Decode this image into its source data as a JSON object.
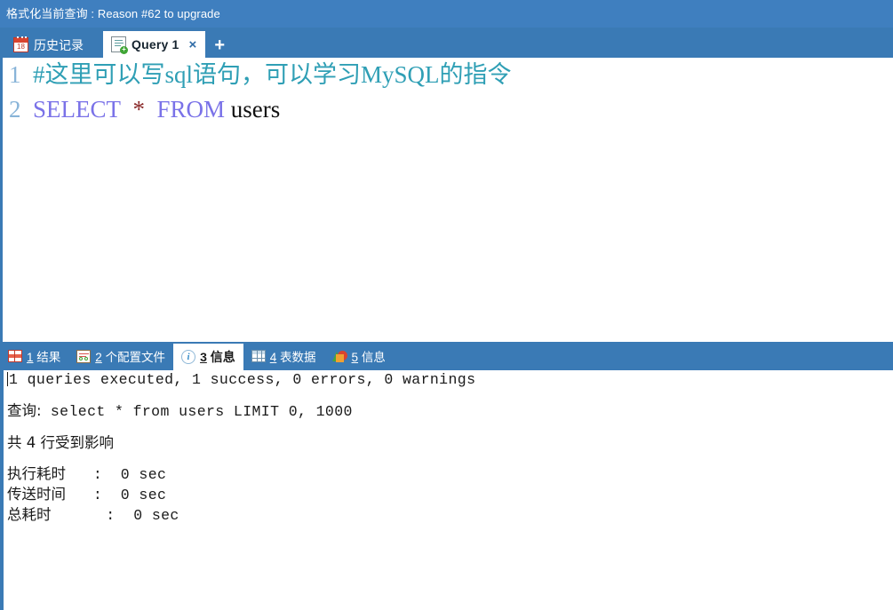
{
  "titlebar": {
    "text": "格式化当前查询 : Reason #62 to upgrade"
  },
  "editor_tabs": {
    "history": {
      "label": "历史记录",
      "icon": "calendar-icon",
      "icon_number": "18"
    },
    "query": {
      "label": "Query 1",
      "icon": "query-document-icon",
      "close": "×"
    },
    "new_tab": "+"
  },
  "code": {
    "lines": [
      {
        "number": "1",
        "tokens": [
          {
            "type": "comment",
            "text": "#这里可以写sql语句，可以学习MySQL的指令"
          }
        ]
      },
      {
        "number": "2",
        "tokens": [
          {
            "type": "keyword",
            "text": "SELECT"
          },
          {
            "type": "plain",
            "text": "  "
          },
          {
            "type": "star",
            "text": "*"
          },
          {
            "type": "plain",
            "text": "  "
          },
          {
            "type": "keyword",
            "text": "FROM"
          },
          {
            "type": "plain",
            "text": " users"
          }
        ]
      }
    ],
    "line1_comment": "#这里可以写sql语句，可以学习MySQL的指令",
    "line2_select": "SELECT",
    "line2_star": "*",
    "line2_from": "FROM",
    "line2_table": "users",
    "line1_number": "1",
    "line2_number": "2"
  },
  "result_tabs": [
    {
      "num": "1",
      "label": "结果",
      "icon": "grid-result-icon",
      "active": false
    },
    {
      "num": "2",
      "label": "个配置文件",
      "icon": "profile-icon",
      "active": false
    },
    {
      "num": "3",
      "label": "信息",
      "icon": "info-circle-icon",
      "active": true
    },
    {
      "num": "4",
      "label": "表数据",
      "icon": "table-grid-icon",
      "active": false
    },
    {
      "num": "5",
      "label": "信息",
      "icon": "pie-chart-icon",
      "active": false
    }
  ],
  "output": {
    "line_executed": "1 queries executed, 1 success, 0 errors, 0 warnings",
    "line_query_label": "查询:",
    "line_query_sql": " select * from users LIMIT 0, 1000",
    "line_rows": "共 4 行受到影响",
    "line_exec_label": "执行耗时",
    "line_exec_value": "   :  0 sec",
    "line_send_label": "传送时间",
    "line_send_value": "   :  0 sec",
    "line_total_label": "总耗时",
    "line_total_value": "      :  0 sec"
  },
  "colors": {
    "titlebar_bg": "#3f7fbf",
    "tabstrip_bg": "#3a7ab5",
    "active_tab_bg": "#ffffff",
    "comment": "#2f9fb5",
    "keyword": "#7a72e8",
    "star": "#8b2b2b",
    "gutter": "#88b4d8"
  }
}
